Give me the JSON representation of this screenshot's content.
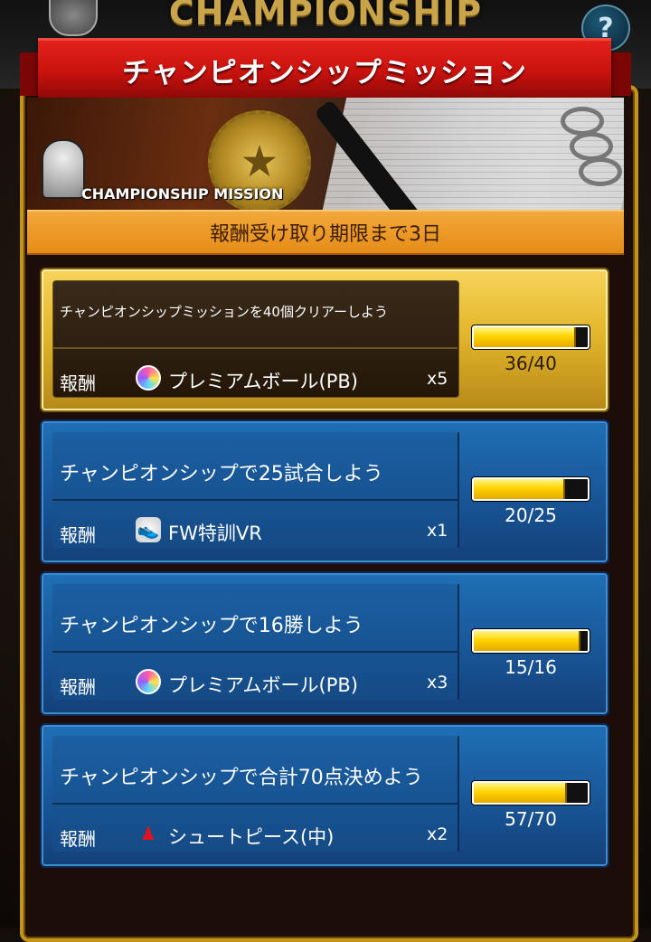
{
  "header": {
    "title": "CHAMPIONSHIP",
    "help_label": "?",
    "banner": "チャンピオンシップミッション"
  },
  "hero": {
    "label": "CHAMPIONSHIP MISSION"
  },
  "deadline": "報酬受け取り期限まで3日",
  "reward_label": "報酬",
  "missions": [
    {
      "title": "チャンピオンシップミッションを40個クリアーしよう",
      "reward_icon": "premium-ball-icon",
      "reward": "プレミアムボール(PB)",
      "qty": "x5",
      "progress": "36/40",
      "current": 36,
      "target": 40
    },
    {
      "title": "チャンピオンシップで25試合しよう",
      "reward_icon": "training-shoe-icon",
      "reward": "FW特訓VR",
      "qty": "x1",
      "progress": "20/25",
      "current": 20,
      "target": 25
    },
    {
      "title": "チャンピオンシップで16勝しよう",
      "reward_icon": "premium-ball-icon",
      "reward": "プレミアムボール(PB)",
      "qty": "x3",
      "progress": "15/16",
      "current": 15,
      "target": 16
    },
    {
      "title": "チャンピオンシップで合計70点決めよう",
      "reward_icon": "shoot-piece-icon",
      "reward": "シュートピース(中)",
      "qty": "x2",
      "progress": "57/70",
      "current": 57,
      "target": 70
    }
  ]
}
